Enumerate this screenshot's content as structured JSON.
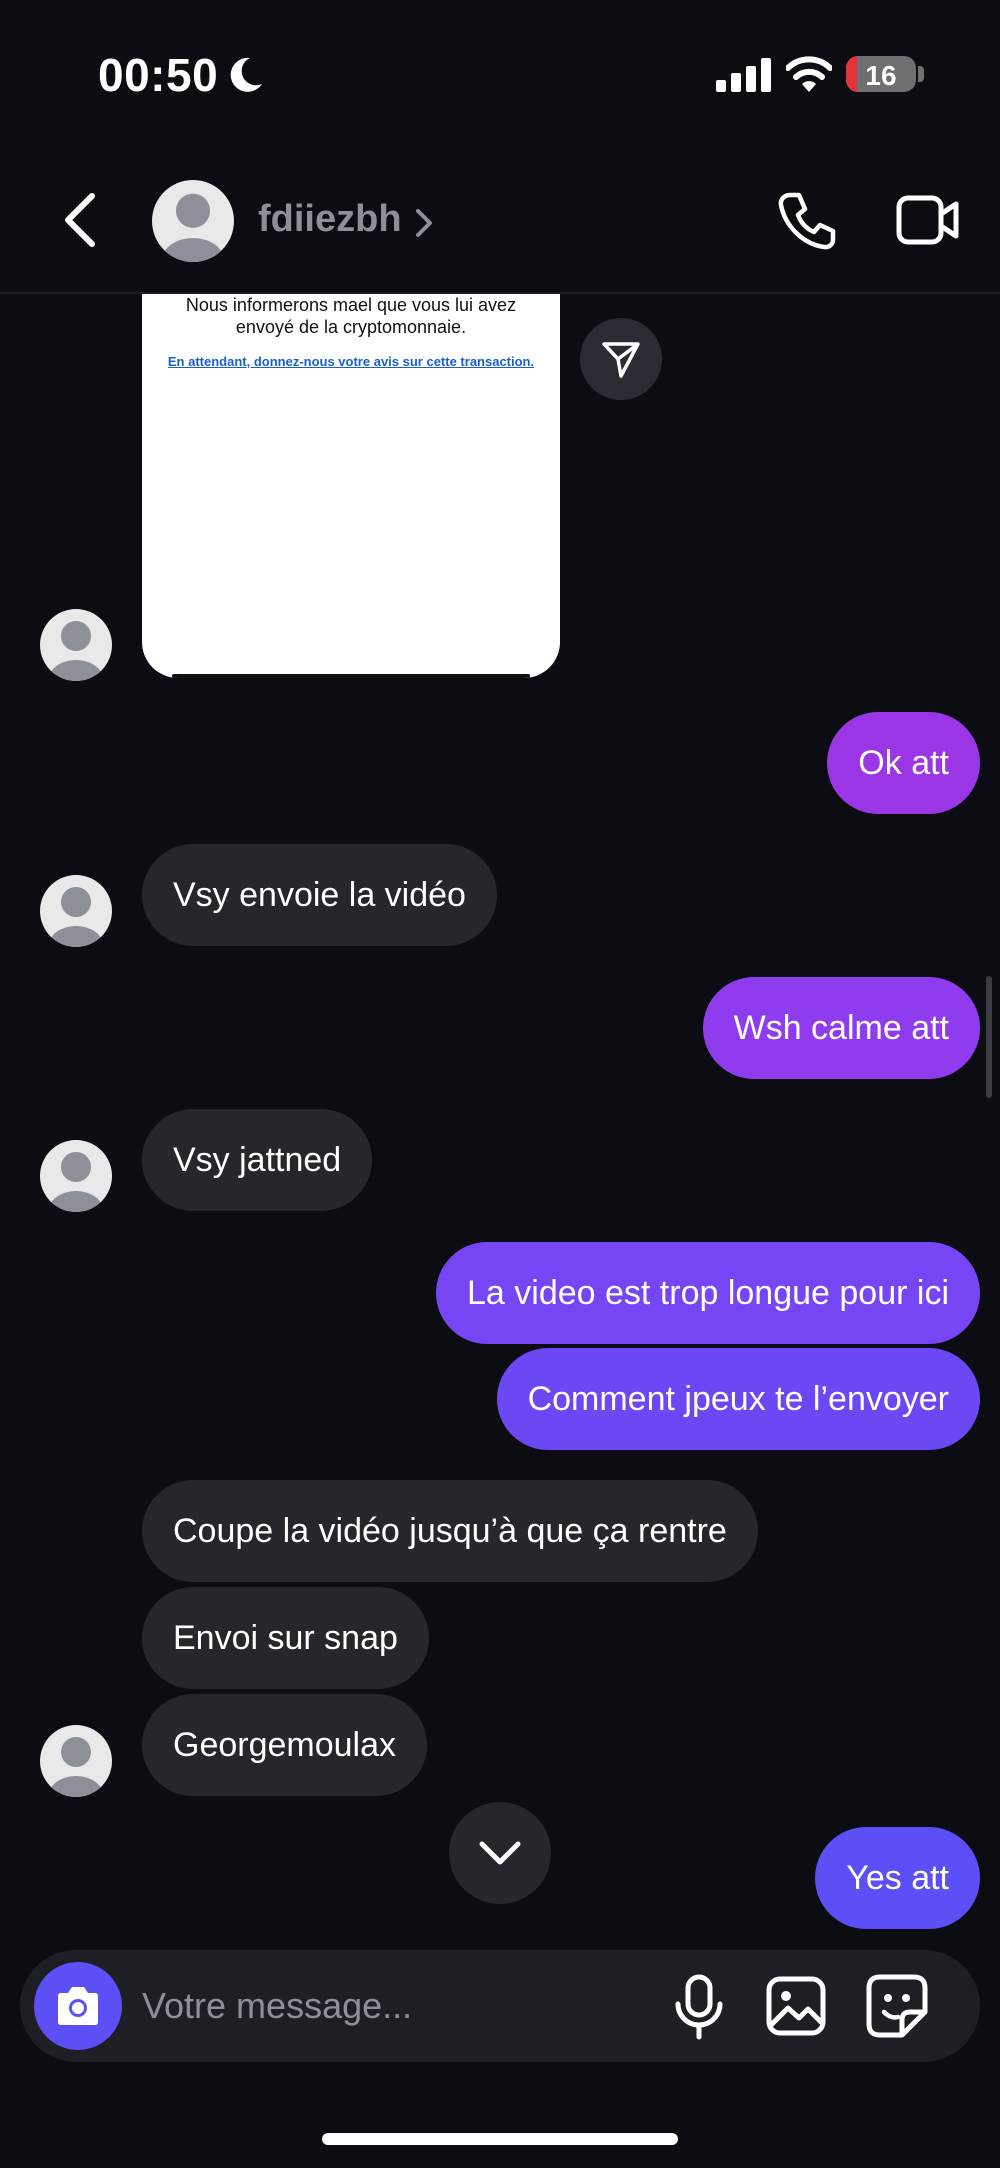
{
  "status_bar": {
    "time": "00:50",
    "battery": "16",
    "battery_level": 0.16,
    "icons": [
      "moon-icon",
      "signal-icon",
      "wifi-icon",
      "battery-icon"
    ]
  },
  "header": {
    "username": "fdiiezbh",
    "icons": [
      "back-chevron-icon",
      "avatar",
      "chevron-right-icon",
      "phone-icon",
      "video-camera-icon"
    ]
  },
  "shared_post": {
    "text": "Nous informerons mael que vous lui avez envoyé de la cryptomonnaie.",
    "link": "En attendant, donnez-nous votre avis sur cette transaction."
  },
  "messages": [
    {
      "dir": "out",
      "text": "Ok att"
    },
    {
      "dir": "in",
      "text": "Vsy envoie la vidéo"
    },
    {
      "dir": "out",
      "text": "Wsh calme att"
    },
    {
      "dir": "in",
      "text": "Vsy jattned"
    },
    {
      "dir": "out",
      "text": "La video est trop longue pour ici"
    },
    {
      "dir": "out",
      "text": "Comment jpeux te l’envoyer"
    },
    {
      "dir": "in",
      "text": "Coupe la vidéo jusqu’à que ça rentre"
    },
    {
      "dir": "in",
      "text": "Envoi sur snap"
    },
    {
      "dir": "in",
      "text": "Georgemoulax"
    },
    {
      "dir": "out",
      "text": "Yes att"
    }
  ],
  "composer": {
    "placeholder": "Votre message..."
  },
  "colors": {
    "background": "#0b0d12",
    "incoming_bubble": "#25272d",
    "outgoing_gradient": [
      "#9b36e6",
      "#5b4ff5"
    ],
    "camera_button": "#5b4ff5"
  }
}
